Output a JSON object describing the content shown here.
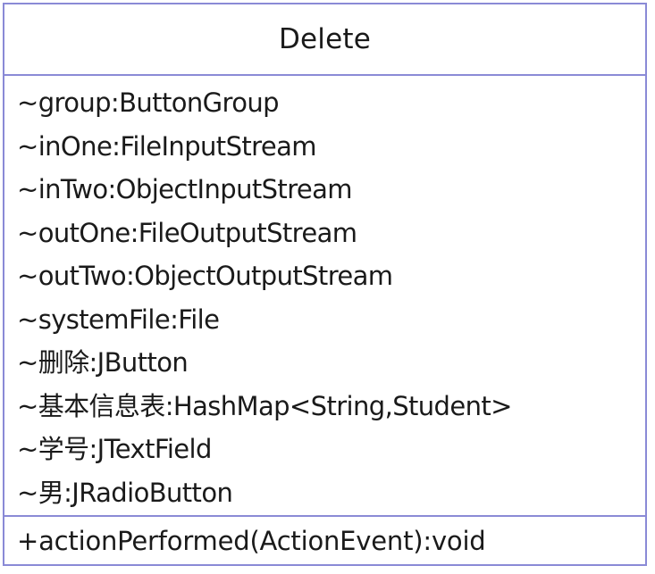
{
  "class": {
    "name": "Delete",
    "attributes": [
      "~group:ButtonGroup",
      "~inOne:FileInputStream",
      "~inTwo:ObjectInputStream",
      "~outOne:FileOutputStream",
      "~outTwo:ObjectOutputStream",
      "~systemFile:File",
      "~删除:JButton",
      "~基本信息表:HashMap<String,Student>",
      "~学号:JTextField",
      "~男:JRadioButton"
    ],
    "operations": [
      "+actionPerformed(ActionEvent):void"
    ]
  },
  "colors": {
    "border": "#8a8ad6",
    "text": "#1a1a1a",
    "background": "#ffffff"
  }
}
